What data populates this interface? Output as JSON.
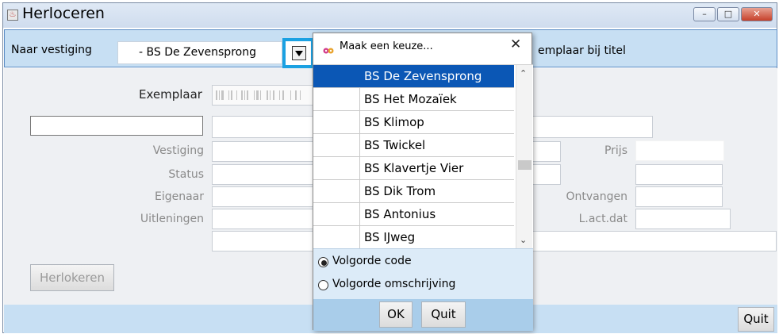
{
  "window": {
    "title": "Herloceren",
    "controls": {
      "minimize": "–",
      "maximize": "□",
      "close": "✕"
    }
  },
  "toolbar": {
    "vestiging_label": "Naar vestiging",
    "vestiging_value": "- BS De Zevensprong",
    "right_text": "emplaar bij titel"
  },
  "form": {
    "exemplaar_label": "Exemplaar",
    "labels": {
      "vestiging": "Vestiging",
      "status": "Status",
      "eigenaar": "Eigenaar",
      "uitleningen": "Uitleningen",
      "prijs": "Prijs",
      "ontvangen": "Ontvangen",
      "lactdat": "L.act.dat"
    },
    "herlokeren_label": "Herlokeren",
    "quit_label": "Quit"
  },
  "dialog": {
    "title": "Maak een keuze...",
    "close_glyph": "✕",
    "items": [
      "BS De Zevensprong",
      "BS Het Mozaïek",
      "BS Klimop",
      "BS Twickel",
      "BS Klavertje Vier",
      "BS Dik Trom",
      "BS Antonius",
      "BS IJweg"
    ],
    "selected_index": 0,
    "sort_options": [
      "Volgorde code",
      "Volgorde omschrijving"
    ],
    "selected_sort": "Volgorde code",
    "ok_label": "OK",
    "quit_label": "Quit"
  },
  "colors": {
    "accent": "#1ba1e2",
    "selection": "#0b57b5",
    "toolbar_bg": "#c7dff3"
  }
}
